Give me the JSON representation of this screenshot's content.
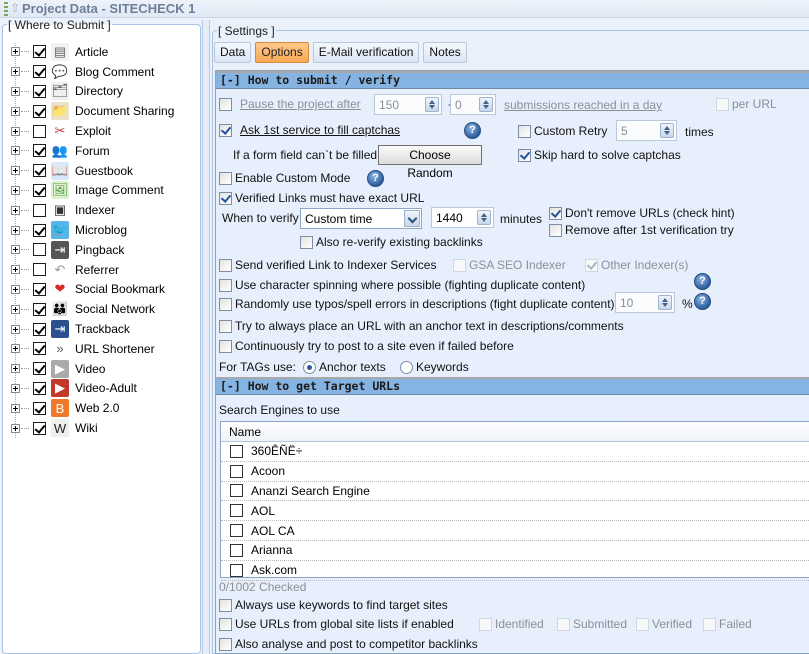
{
  "window": {
    "title": "Project Data - SITECHECK 1"
  },
  "where_to_submit": {
    "caption": "[ Where to Submit ]",
    "items": [
      {
        "label": "Article",
        "checked": true,
        "icon": "article-icon",
        "glyph": "▤"
      },
      {
        "label": "Blog Comment",
        "checked": true,
        "icon": "speech-bubble-icon",
        "glyph": "💬"
      },
      {
        "label": "Directory",
        "checked": true,
        "icon": "directory-icon",
        "glyph": "🗂"
      },
      {
        "label": "Document Sharing",
        "checked": true,
        "icon": "folder-icon",
        "glyph": "📁"
      },
      {
        "label": "Exploit",
        "checked": false,
        "icon": "broken-link-icon",
        "glyph": "✂"
      },
      {
        "label": "Forum",
        "checked": true,
        "icon": "users-icon",
        "glyph": "👥"
      },
      {
        "label": "Guestbook",
        "checked": true,
        "icon": "open-book-icon",
        "glyph": "📖"
      },
      {
        "label": "Image Comment",
        "checked": true,
        "icon": "image-icon",
        "glyph": "🖼"
      },
      {
        "label": "Indexer",
        "checked": false,
        "icon": "indexer-icon",
        "glyph": "▣"
      },
      {
        "label": "Microblog",
        "checked": true,
        "icon": "twitter-bird-icon",
        "glyph": "🐦"
      },
      {
        "label": "Pingback",
        "checked": false,
        "icon": "pingback-icon",
        "glyph": "⇥"
      },
      {
        "label": "Referrer",
        "checked": false,
        "icon": "referrer-arrow-icon",
        "glyph": "↶"
      },
      {
        "label": "Social Bookmark",
        "checked": true,
        "icon": "heart-icon",
        "glyph": "❤"
      },
      {
        "label": "Social Network",
        "checked": true,
        "icon": "people-icon",
        "glyph": "👪"
      },
      {
        "label": "Trackback",
        "checked": true,
        "icon": "trackback-icon",
        "glyph": "⇥"
      },
      {
        "label": "URL Shortener",
        "checked": true,
        "icon": "double-chevron-icon",
        "glyph": "»"
      },
      {
        "label": "Video",
        "checked": true,
        "icon": "film-icon",
        "glyph": "▶"
      },
      {
        "label": "Video-Adult",
        "checked": true,
        "icon": "red-film-icon",
        "glyph": "▶"
      },
      {
        "label": "Web 2.0",
        "checked": true,
        "icon": "blogger-icon",
        "glyph": "B"
      },
      {
        "label": "Wiki",
        "checked": true,
        "icon": "wikipedia-icon",
        "glyph": "W"
      }
    ]
  },
  "settings": {
    "caption": "[ Settings ]",
    "tabs": [
      {
        "label": "Data",
        "active": false
      },
      {
        "label": "Options",
        "active": true
      },
      {
        "label": "E-Mail verification",
        "active": false
      },
      {
        "label": "Notes",
        "active": false
      }
    ],
    "how_to_submit": {
      "header": "[-] How to submit / verify",
      "pause_label": "Pause the project after",
      "pause_checked": false,
      "pause_value": "150",
      "plusminus": "+/-",
      "pause_variance": "0",
      "pause_suffix": "submissions reached in a day",
      "per_url": "per URL",
      "ask_captcha_label": "Ask 1st service to fill captchas",
      "ask_captcha_checked": true,
      "custom_retry_label": "Custom Retry",
      "custom_retry_checked": false,
      "custom_retry_value": "5",
      "times_label": "times",
      "form_field_label": "If a form field can`t be filled",
      "choose_random_button": "Choose Random",
      "skip_hard_label": "Skip hard to solve captchas",
      "skip_hard_checked": true,
      "custom_mode_label": "Enable Custom Mode",
      "custom_mode_checked": false,
      "exact_url_label": "Verified Links must have exact URL",
      "exact_url_checked": true,
      "when_verify_label": "When to verify",
      "when_verify_value": "Custom time",
      "minutes_value": "1440",
      "minutes_label": "minutes",
      "dont_remove_label": "Don't remove URLs (check hint)",
      "dont_remove_checked": true,
      "remove_after_label": "Remove after 1st verification try",
      "remove_after_checked": false,
      "reverify_label": "Also re-verify existing backlinks",
      "reverify_checked": false,
      "send_indexer_label": "Send verified Link to Indexer Services",
      "send_indexer_checked": false,
      "gsa_indexer_label": "GSA SEO Indexer",
      "other_indexer_label": "Other Indexer(s)",
      "spinning_label": "Use character spinning where possible (fighting duplicate content)",
      "typos_label": "Randomly use typos/spell errors in descriptions (fight duplicate content)",
      "typos_value": "10",
      "percent": "%",
      "anchor_label": "Try to always place an URL with an anchor text in descriptions/comments",
      "continuous_label": "Continuously try to post to a site even if failed before",
      "tags_label": "For TAGs use:",
      "tags_options": [
        "Anchor texts",
        "Keywords"
      ],
      "tags_selected": "Anchor texts",
      "help_glyph": "?"
    },
    "target_urls": {
      "header": "[-] How to get Target URLs",
      "engines_label": "Search Engines to use",
      "column_name": "Name",
      "engines": [
        "360ÊÑË÷",
        "Acoon",
        "Ananzi Search Engine",
        "AOL",
        "AOL CA",
        "Arianna",
        "Ask.com"
      ],
      "checked_count": "0/1002 Checked",
      "always_keywords_label": "Always use keywords to find target sites",
      "global_lists_label": "Use URLs from global site lists if enabled",
      "global_list_types": [
        "Identified",
        "Submitted",
        "Verified",
        "Failed"
      ],
      "competitor_label": "Also analyse and post to competitor backlinks"
    }
  }
}
